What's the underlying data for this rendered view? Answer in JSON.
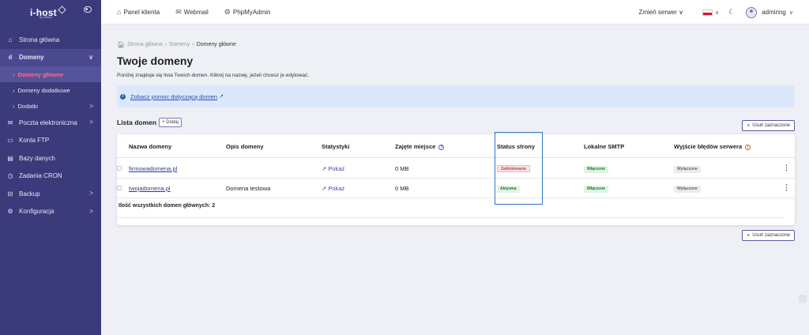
{
  "brand": {
    "name": "i-host",
    "tagline": "by Webd"
  },
  "sidebar": {
    "items": [
      {
        "label": "Strona główna",
        "icon": "home-icon",
        "glyph": "⌂"
      },
      {
        "label": "Domeny",
        "icon": "chart-icon",
        "glyph": "ıl",
        "chevron": "∨"
      },
      {
        "label": "Domeny główne",
        "sub": true
      },
      {
        "label": "Domeny dodatkowe",
        "sub": true
      },
      {
        "label": "Dodatki",
        "sub": true,
        "chevron": ">"
      },
      {
        "label": "Poczta elektroniczna",
        "icon": "mail-icon",
        "glyph": "✉",
        "chevron": ">"
      },
      {
        "label": "Konta FTP",
        "icon": "ftp-icon",
        "glyph": "▭"
      },
      {
        "label": "Bazy danych",
        "icon": "database-icon",
        "glyph": "▤"
      },
      {
        "label": "Zadania CRON",
        "icon": "clock-icon",
        "glyph": "◷"
      },
      {
        "label": "Backup",
        "icon": "backup-icon",
        "glyph": "⊟",
        "chevron": ">"
      },
      {
        "label": "Konfiguracja",
        "icon": "gear-icon",
        "glyph": "⚙",
        "chevron": ">"
      }
    ]
  },
  "topbar": {
    "links": [
      {
        "label": "Panel klienta",
        "glyph": "⌂"
      },
      {
        "label": "Webmail",
        "glyph": "✉"
      },
      {
        "label": "PhpMyAdmin",
        "glyph": "⚙"
      }
    ],
    "server_label": "Zmień serwer",
    "user": "adminng",
    "caret": "∨",
    "moon": "☾"
  },
  "breadcrumb": {
    "home": "Strona główna",
    "mid": "Domeny",
    "current": "Domeny główne",
    "sep": "›"
  },
  "page": {
    "title": "Twoje domeny",
    "subtitle": "Poniżej znajduje się lista Twoich domen. Kliknij na nazwę, jeżeli chcesz je edytować.",
    "help_link": "Zobacz pomoc dotyczącą domen",
    "list_title": "Lista domen",
    "add_label": "Dodaj",
    "delete_selected": "Usuń zaznaczone"
  },
  "table": {
    "headers": {
      "name": "Nazwa domeny",
      "desc": "Opis domeny",
      "stats": "Statystyki",
      "space": "Zajęte miejsce",
      "status": "Status strony",
      "smtp": "Lokalne SMTP",
      "errors": "Wyjście błędów serwera"
    },
    "rows": [
      {
        "name": "firmowadomena.pl",
        "desc": "",
        "stats": "Pokaż",
        "space": "0 MB",
        "status": "Zablokowana",
        "smtp": "Włączone",
        "errors": "Wyłączone"
      },
      {
        "name": "twojadomena.pl",
        "desc": "Domena testowa",
        "stats": "Pokaż",
        "space": "0 MB",
        "status": "Aktywna",
        "smtp": "Włączone",
        "errors": "Wyłączone"
      }
    ],
    "total": "Ilość wszystkich domen głównych: 2"
  },
  "colors": {
    "sidebar": "#3b3a7a",
    "accent": "#ff6b8b",
    "highlight": "#2f74c0"
  }
}
